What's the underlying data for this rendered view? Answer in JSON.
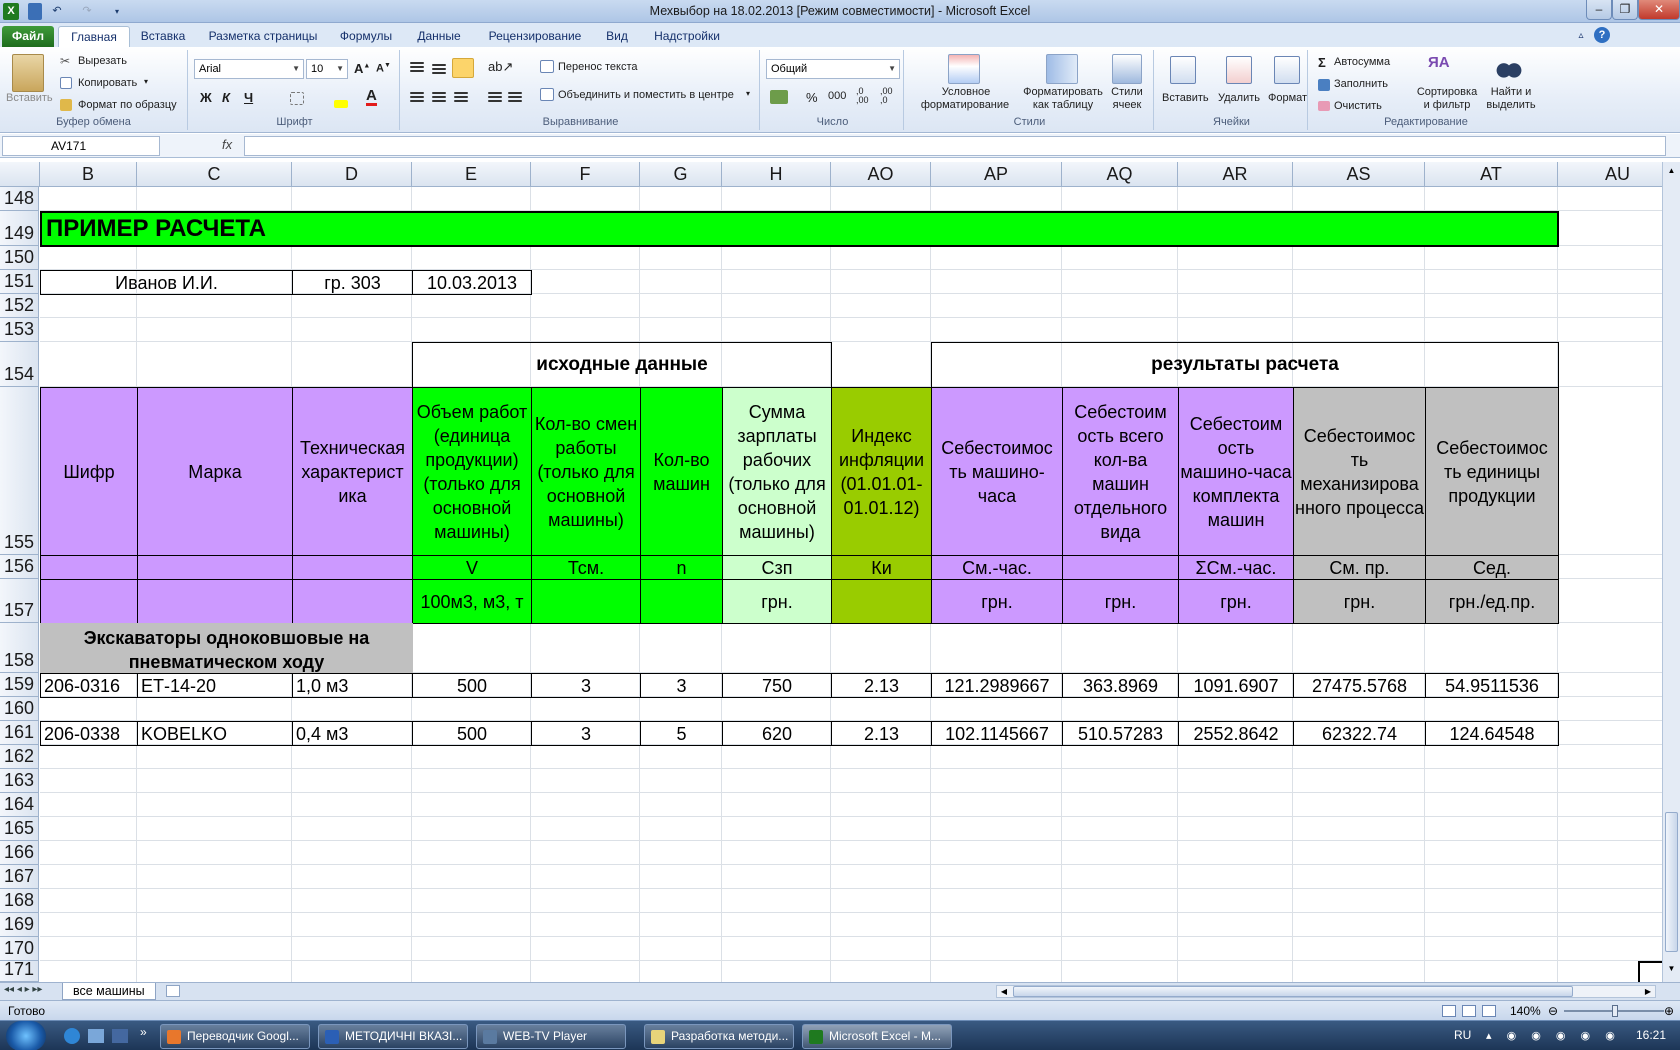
{
  "window": {
    "title": "Мехвыбор на 18.02.2013  [Режим совместимости]  -  Microsoft Excel"
  },
  "tabs": [
    "Файл",
    "Главная",
    "Вставка",
    "Разметка страницы",
    "Формулы",
    "Данные",
    "Рецензирование",
    "Вид",
    "Надстройки"
  ],
  "ribbon": {
    "clipboard": {
      "paste": "Вставить",
      "cut": "Вырезать",
      "copy": "Копировать",
      "format_painter": "Формат по образцу",
      "label": "Буфер обмена"
    },
    "font": {
      "name": "Arial",
      "size": "10",
      "label": "Шрифт",
      "bold": "Ж",
      "italic": "К",
      "underline": "Ч"
    },
    "alignment": {
      "wrap": "Перенос текста",
      "merge": "Объединить и поместить в центре",
      "label": "Выравнивание"
    },
    "number": {
      "format": "Общий",
      "percent": "%",
      "thousands": "000",
      "label": "Число"
    },
    "styles": {
      "conditional_1": "Условное",
      "conditional_2": "форматирование",
      "as_table_1": "Форматировать",
      "as_table_2": "как таблицу",
      "cell_styles_1": "Стили",
      "cell_styles_2": "ячеек",
      "label": "Стили"
    },
    "cells": {
      "insert": "Вставить",
      "delete": "Удалить",
      "format": "Формат",
      "label": "Ячейки"
    },
    "editing": {
      "autosum": "Автосумма",
      "fill": "Заполнить",
      "clear": "Очистить",
      "sort_1": "Сортировка",
      "sort_2": "и фильтр",
      "find_1": "Найти и",
      "find_2": "выделить",
      "label": "Редактирование"
    }
  },
  "formula_bar": {
    "name_box": "AV171",
    "fx": "fx",
    "value": ""
  },
  "columns": [
    "B",
    "C",
    "D",
    "E",
    "F",
    "G",
    "H",
    "AO",
    "AP",
    "AQ",
    "AR",
    "AS",
    "AT",
    "AU"
  ],
  "rows": [
    "148",
    "149",
    "150",
    "151",
    "152",
    "153",
    "154",
    "155",
    "156",
    "157",
    "158",
    "159",
    "160",
    "161",
    "162",
    "163",
    "164",
    "165",
    "166",
    "167",
    "168",
    "169",
    "170",
    "171"
  ],
  "sheet": {
    "banner": "ПРИМЕР РАСЧЕТА",
    "student": "Иванов И.И.",
    "group": "гр. 303",
    "date": "10.03.2013",
    "section_input": "исходные данные",
    "section_results": "результаты расчета",
    "headers": [
      "Шифр",
      "Марка",
      "Техническая характерист ика",
      "Объем работ (единица продукции) (только для основной машины)",
      "Кол-во смен работы (только для основной машины)",
      "Кол-во машин",
      "Сумма зарплаты рабочих (только для основной машины)",
      "Индекс инфляции (01.01.01-01.01.12)",
      "Себестоимос ть машино-часа",
      "Себестоим ость всего кол-ва машин отдельного вида",
      "Себестоим ость машино-часа комплекта машин",
      "Себестоимос ть механизирова нного процесса",
      "Себестоимос ть единицы продукции"
    ],
    "symbols": [
      "",
      "",
      "",
      "V",
      "Тсм.",
      "n",
      "Сзп",
      "Ки",
      "См.-час.",
      "",
      "ΣСм.-час.",
      "См. пр.",
      "Сед."
    ],
    "units": [
      "",
      "",
      "",
      "100м3, м3, т",
      "",
      "",
      "грн.",
      "",
      "грн.",
      "грн.",
      "грн.",
      "грн.",
      "грн./ед.пр."
    ],
    "category": "Экскаваторы одноковшовые на пневматическом ходу",
    "data_rows": [
      [
        "206-0316",
        "ЕТ-14-20",
        "1,0 м3",
        "500",
        "3",
        "3",
        "750",
        "2.13",
        "121.2989667",
        "363.8969",
        "1091.6907",
        "27475.5768",
        "54.9511536"
      ],
      [
        "206-0338",
        "KOBELKO",
        "0,4 м3",
        "500",
        "3",
        "5",
        "620",
        "2.13",
        "102.1145667",
        "510.57283",
        "2552.8642",
        "62322.74",
        "124.64548"
      ]
    ]
  },
  "sheet_tab": "все машины",
  "status": {
    "ready": "Готово",
    "zoom": "140%"
  },
  "taskbar": {
    "items": [
      "Переводчик Googl...",
      "МЕТОДИЧНІ ВКАЗІ...",
      "WEB-TV Player",
      "Разработка методи...",
      "Microsoft Excel - M..."
    ],
    "lang": "RU",
    "clock": "16:21"
  }
}
